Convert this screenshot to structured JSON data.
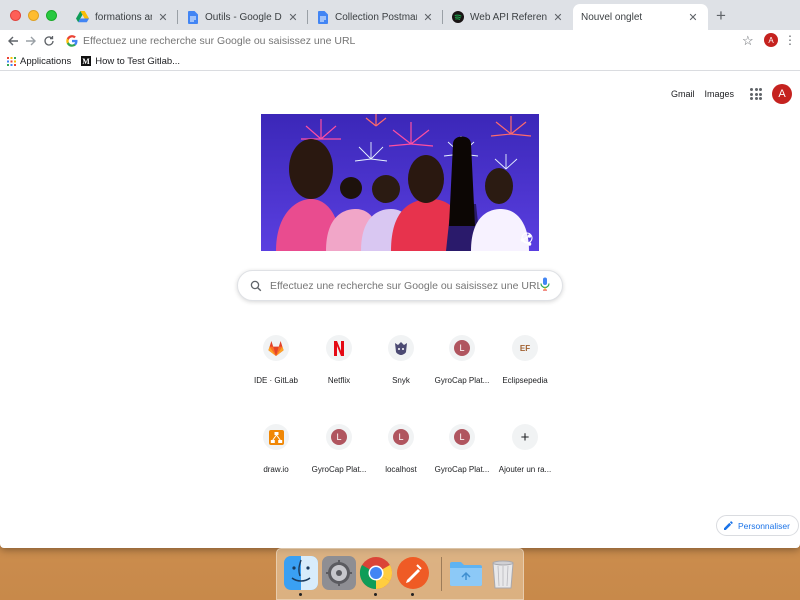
{
  "browser": {
    "tabs": [
      {
        "title": "formations arrivants - Google",
        "icon": "google-drive-icon"
      },
      {
        "title": "Outils - Google Docs",
        "icon": "google-docs-icon"
      },
      {
        "title": "Collection Postman - Google",
        "icon": "google-docs-icon"
      },
      {
        "title": "Web API Reference | Spotify f",
        "icon": "spotify-icon"
      },
      {
        "title": "Nouvel onglet",
        "icon": "none"
      }
    ],
    "new_tab_symbol": "+",
    "omnibox_placeholder": "Effectuez une recherche sur Google ou saisissez une URL",
    "profile_initial": "A"
  },
  "bookmarks": [
    {
      "label": "Applications",
      "icon": "apps-grid-icon"
    },
    {
      "label": "How to Test Gitlab...",
      "icon": "medium-icon"
    }
  ],
  "header": {
    "gmail": "Gmail",
    "images": "Images",
    "avatar_initial": "A"
  },
  "search": {
    "placeholder": "Effectuez une recherche sur Google ou saisissez une URL"
  },
  "shortcuts": [
    {
      "label": "IDE · GitLab",
      "icon": "gitlab-icon"
    },
    {
      "label": "Netflix",
      "icon": "netflix-icon"
    },
    {
      "label": "Snyk",
      "icon": "snyk-icon"
    },
    {
      "label": "GyroCap Plat...",
      "icon": "letter-icon",
      "letter": "L"
    },
    {
      "label": "Eclipsepedia",
      "icon": "eclipse-icon",
      "letter": "EF"
    },
    {
      "label": "draw.io",
      "icon": "drawio-icon"
    },
    {
      "label": "GyroCap Plat...",
      "icon": "letter-icon",
      "letter": "L"
    },
    {
      "label": "localhost",
      "icon": "letter-icon",
      "letter": "L"
    },
    {
      "label": "GyroCap Plat...",
      "icon": "letter-icon",
      "letter": "L"
    },
    {
      "label": "Ajouter un ra...",
      "icon": "plus-icon",
      "letter": "+"
    }
  ],
  "customize_button": "Personnaliser",
  "colors": {
    "tabstrip": "#dee1e6",
    "accent_blue": "#1a73e8",
    "avatar_red": "#c5221f",
    "letter_tile": "#b0555f"
  },
  "dock": [
    {
      "name": "finder-icon"
    },
    {
      "name": "system-preferences-icon"
    },
    {
      "name": "chrome-icon"
    },
    {
      "name": "postman-icon"
    },
    {
      "name": "folder-icon"
    },
    {
      "name": "trash-icon"
    }
  ]
}
